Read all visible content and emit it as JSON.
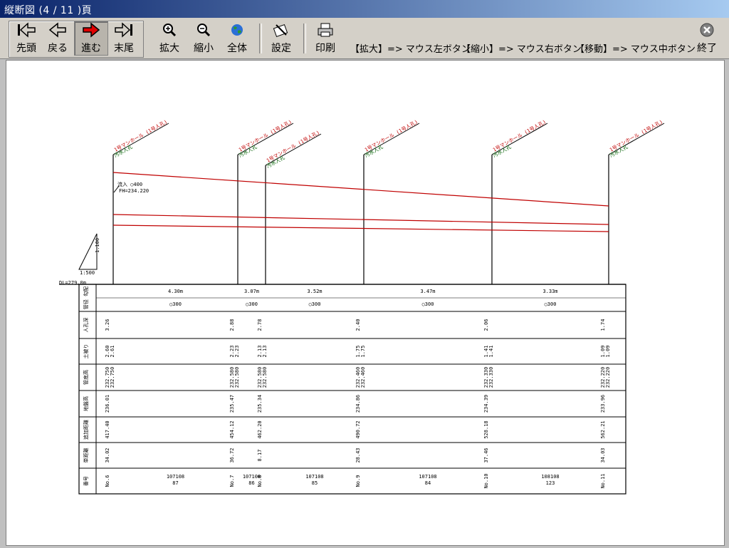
{
  "window": {
    "title": "縦断図 (4 / 11 )頁"
  },
  "toolbar": {
    "first": "先頭",
    "back": "戻る",
    "next": "進む",
    "last": "末尾",
    "zoom_in": "拡大",
    "zoom_out": "縮小",
    "whole": "全体",
    "settings": "設定",
    "print": "印刷",
    "exit": "終了",
    "hint_zoom_in": "【拡大】=> マウス左ボタン",
    "hint_zoom_out": "【縮小】=> マウス右ボタン",
    "hint_move": "【移動】=> マウス中ボタン"
  },
  "drawing": {
    "scale_v": "1:100",
    "scale_h": "1:500",
    "datum": "DL=279.0m",
    "callout_1": "流入 ○400",
    "callout_2": "FH=234.220",
    "manholes": [
      {
        "label": "1号マンホール (1号人孔)",
        "sub": "汚水人孔"
      },
      {
        "label": "1号マンホール (1号人孔)",
        "sub": "汚水人孔"
      },
      {
        "label": "1号マンホール (1号人孔)",
        "sub": "汚水人孔"
      },
      {
        "label": "1号マンホール (1号人孔)",
        "sub": "汚水人孔"
      },
      {
        "label": "1号マンホール (1号人孔)",
        "sub": "汚水人孔"
      },
      {
        "label": "1号マンホール (1号人孔)",
        "sub": "汚水人孔"
      }
    ],
    "spans": [
      {
        "length": "4.30m",
        "pipe": "○300"
      },
      {
        "length": "3.07m",
        "pipe": "○300"
      },
      {
        "length": "3.52m",
        "pipe": "○300"
      },
      {
        "length": "3.47m",
        "pipe": "○300"
      },
      {
        "length": "3.33m",
        "pipe": "○300"
      }
    ]
  },
  "table": {
    "row_labels": [
      "管径 勾配",
      "人孔深",
      "土被り",
      "管底高",
      "地盤高",
      "追加距離",
      "単距離",
      "番号"
    ],
    "depth": [
      "3.26",
      "2.88",
      "2.78",
      "2.40",
      "2.06",
      "1.74"
    ],
    "cover": [
      "2.60\n2.61",
      "2.23\n2.23",
      "2.13\n2.13",
      "1.75\n1.75",
      "1.41\n1.41",
      "1.09\n1.09"
    ],
    "invert": [
      "232.750\n232.750",
      "232.580\n232.580",
      "232.580\n232.580",
      "232.460\n232.460",
      "232.330\n232.330",
      "232.220\n232.220"
    ],
    "ground": [
      "236.01",
      "235.47",
      "235.34",
      "234.86",
      "234.39",
      "233.96"
    ],
    "cumulative": [
      "417.40",
      "454.12",
      "462.20",
      "490.72",
      "528.18",
      "562.21"
    ],
    "single": [
      "34.02",
      "36.72",
      "8.17",
      "28.43",
      "37.46",
      "34.03"
    ],
    "numbers": [
      "No.6",
      "No.7",
      "No.8",
      "No.9",
      "No.10",
      "No.11"
    ],
    "span_codes": [
      {
        "a": "107108",
        "b": "87"
      },
      {
        "a": "107108",
        "b": "86"
      },
      {
        "a": "107108",
        "b": "85"
      },
      {
        "a": "107108",
        "b": "84"
      },
      {
        "a": "108108",
        "b": "123"
      }
    ]
  }
}
